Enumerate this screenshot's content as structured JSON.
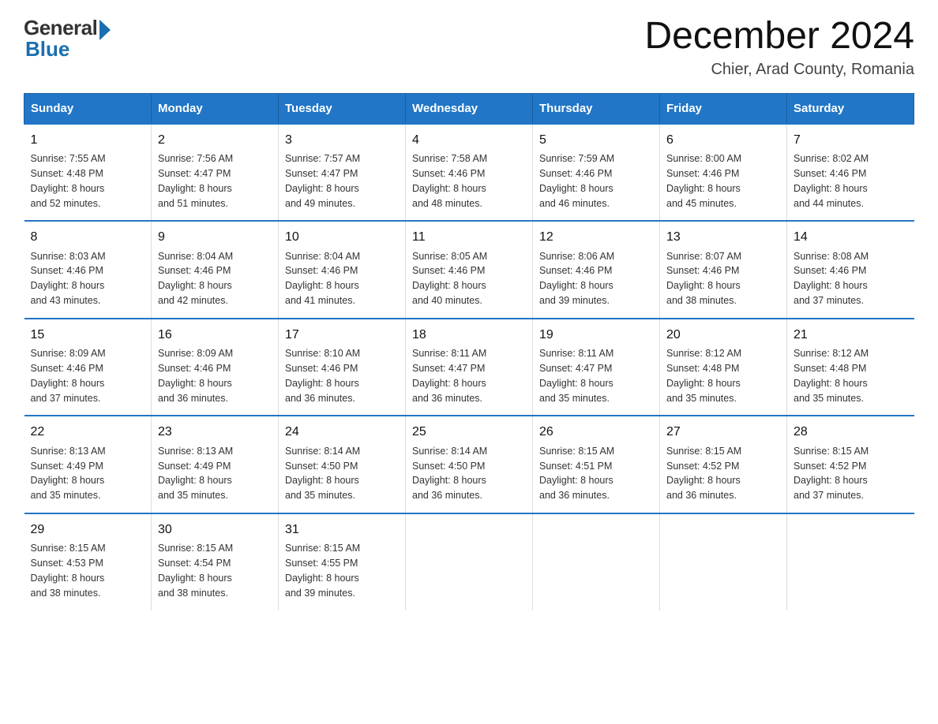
{
  "logo": {
    "general": "General",
    "blue": "Blue"
  },
  "calendar": {
    "title": "December 2024",
    "subtitle": "Chier, Arad County, Romania"
  },
  "weekdays": [
    "Sunday",
    "Monday",
    "Tuesday",
    "Wednesday",
    "Thursday",
    "Friday",
    "Saturday"
  ],
  "weeks": [
    [
      {
        "day": "1",
        "sunrise": "7:55 AM",
        "sunset": "4:48 PM",
        "daylight": "8 hours and 52 minutes."
      },
      {
        "day": "2",
        "sunrise": "7:56 AM",
        "sunset": "4:47 PM",
        "daylight": "8 hours and 51 minutes."
      },
      {
        "day": "3",
        "sunrise": "7:57 AM",
        "sunset": "4:47 PM",
        "daylight": "8 hours and 49 minutes."
      },
      {
        "day": "4",
        "sunrise": "7:58 AM",
        "sunset": "4:46 PM",
        "daylight": "8 hours and 48 minutes."
      },
      {
        "day": "5",
        "sunrise": "7:59 AM",
        "sunset": "4:46 PM",
        "daylight": "8 hours and 46 minutes."
      },
      {
        "day": "6",
        "sunrise": "8:00 AM",
        "sunset": "4:46 PM",
        "daylight": "8 hours and 45 minutes."
      },
      {
        "day": "7",
        "sunrise": "8:02 AM",
        "sunset": "4:46 PM",
        "daylight": "8 hours and 44 minutes."
      }
    ],
    [
      {
        "day": "8",
        "sunrise": "8:03 AM",
        "sunset": "4:46 PM",
        "daylight": "8 hours and 43 minutes."
      },
      {
        "day": "9",
        "sunrise": "8:04 AM",
        "sunset": "4:46 PM",
        "daylight": "8 hours and 42 minutes."
      },
      {
        "day": "10",
        "sunrise": "8:04 AM",
        "sunset": "4:46 PM",
        "daylight": "8 hours and 41 minutes."
      },
      {
        "day": "11",
        "sunrise": "8:05 AM",
        "sunset": "4:46 PM",
        "daylight": "8 hours and 40 minutes."
      },
      {
        "day": "12",
        "sunrise": "8:06 AM",
        "sunset": "4:46 PM",
        "daylight": "8 hours and 39 minutes."
      },
      {
        "day": "13",
        "sunrise": "8:07 AM",
        "sunset": "4:46 PM",
        "daylight": "8 hours and 38 minutes."
      },
      {
        "day": "14",
        "sunrise": "8:08 AM",
        "sunset": "4:46 PM",
        "daylight": "8 hours and 37 minutes."
      }
    ],
    [
      {
        "day": "15",
        "sunrise": "8:09 AM",
        "sunset": "4:46 PM",
        "daylight": "8 hours and 37 minutes."
      },
      {
        "day": "16",
        "sunrise": "8:09 AM",
        "sunset": "4:46 PM",
        "daylight": "8 hours and 36 minutes."
      },
      {
        "day": "17",
        "sunrise": "8:10 AM",
        "sunset": "4:46 PM",
        "daylight": "8 hours and 36 minutes."
      },
      {
        "day": "18",
        "sunrise": "8:11 AM",
        "sunset": "4:47 PM",
        "daylight": "8 hours and 36 minutes."
      },
      {
        "day": "19",
        "sunrise": "8:11 AM",
        "sunset": "4:47 PM",
        "daylight": "8 hours and 35 minutes."
      },
      {
        "day": "20",
        "sunrise": "8:12 AM",
        "sunset": "4:48 PM",
        "daylight": "8 hours and 35 minutes."
      },
      {
        "day": "21",
        "sunrise": "8:12 AM",
        "sunset": "4:48 PM",
        "daylight": "8 hours and 35 minutes."
      }
    ],
    [
      {
        "day": "22",
        "sunrise": "8:13 AM",
        "sunset": "4:49 PM",
        "daylight": "8 hours and 35 minutes."
      },
      {
        "day": "23",
        "sunrise": "8:13 AM",
        "sunset": "4:49 PM",
        "daylight": "8 hours and 35 minutes."
      },
      {
        "day": "24",
        "sunrise": "8:14 AM",
        "sunset": "4:50 PM",
        "daylight": "8 hours and 35 minutes."
      },
      {
        "day": "25",
        "sunrise": "8:14 AM",
        "sunset": "4:50 PM",
        "daylight": "8 hours and 36 minutes."
      },
      {
        "day": "26",
        "sunrise": "8:15 AM",
        "sunset": "4:51 PM",
        "daylight": "8 hours and 36 minutes."
      },
      {
        "day": "27",
        "sunrise": "8:15 AM",
        "sunset": "4:52 PM",
        "daylight": "8 hours and 36 minutes."
      },
      {
        "day": "28",
        "sunrise": "8:15 AM",
        "sunset": "4:52 PM",
        "daylight": "8 hours and 37 minutes."
      }
    ],
    [
      {
        "day": "29",
        "sunrise": "8:15 AM",
        "sunset": "4:53 PM",
        "daylight": "8 hours and 38 minutes."
      },
      {
        "day": "30",
        "sunrise": "8:15 AM",
        "sunset": "4:54 PM",
        "daylight": "8 hours and 38 minutes."
      },
      {
        "day": "31",
        "sunrise": "8:15 AM",
        "sunset": "4:55 PM",
        "daylight": "8 hours and 39 minutes."
      },
      null,
      null,
      null,
      null
    ]
  ],
  "labels": {
    "sunrise": "Sunrise:",
    "sunset": "Sunset:",
    "daylight": "Daylight:"
  }
}
